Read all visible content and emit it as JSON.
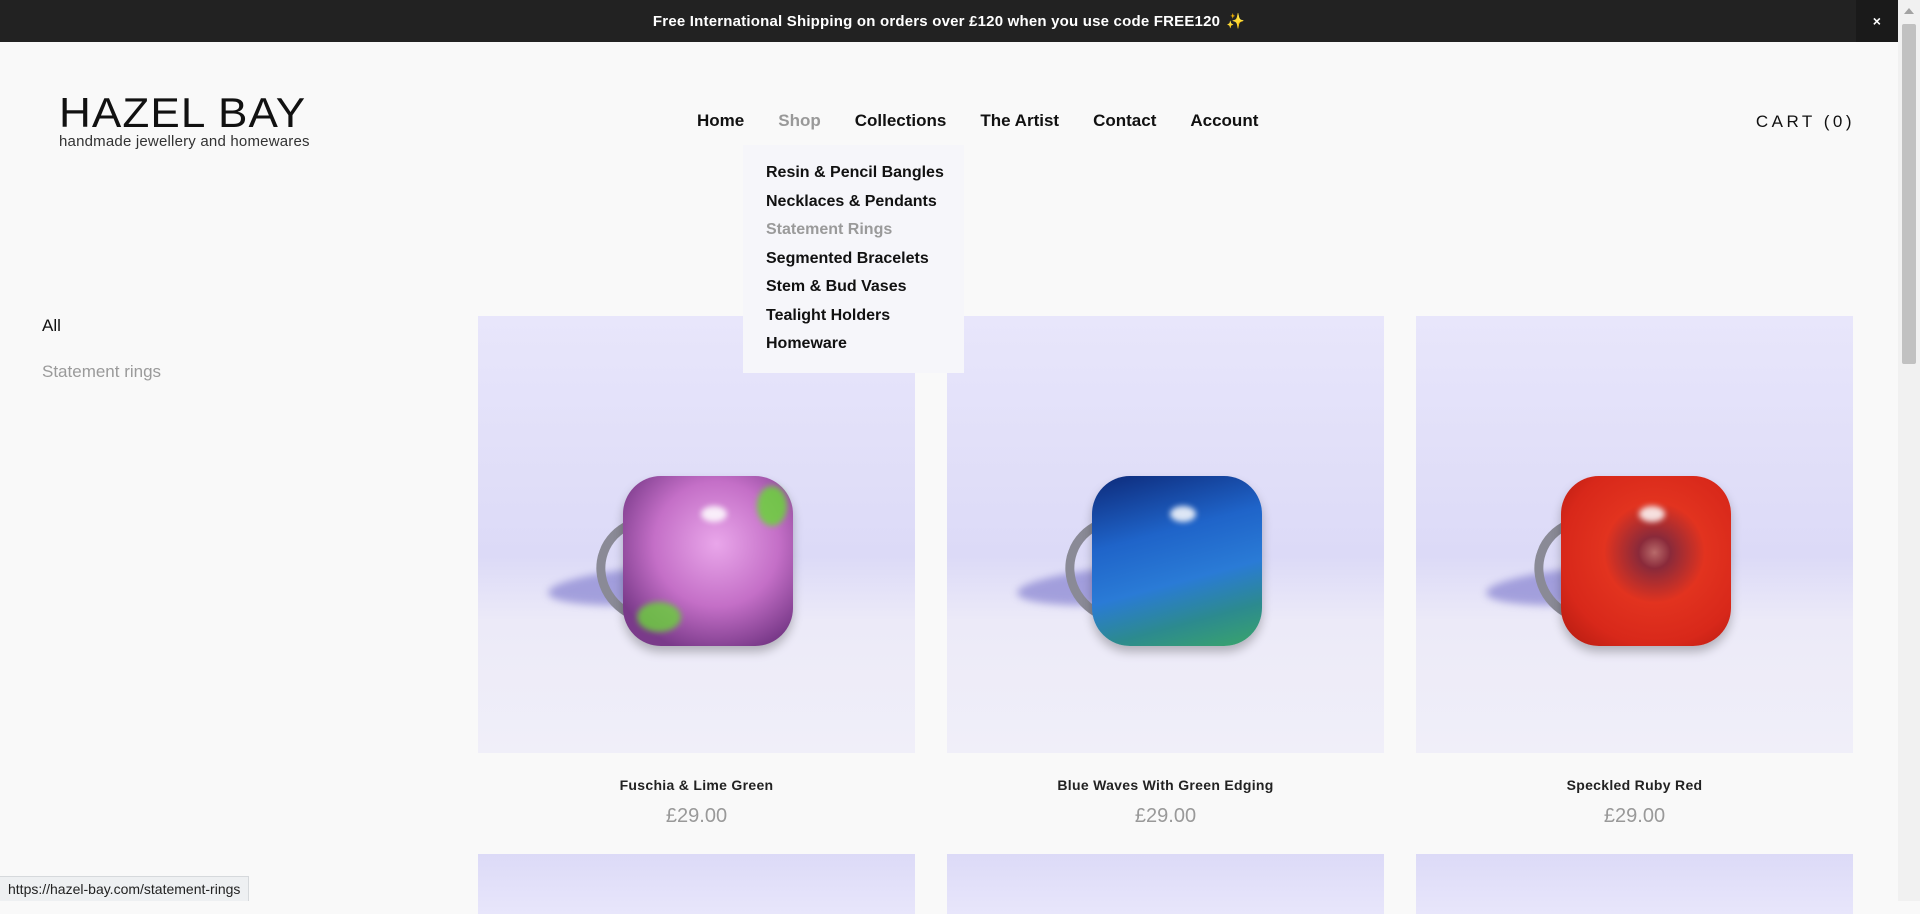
{
  "announcement": {
    "text": "Free International Shipping on orders over £120 when you use code FREE120",
    "emoji": "✨",
    "close_label": "×"
  },
  "logo": {
    "title": "HAZEL BAY",
    "tagline": "handmade jewellery and homewares"
  },
  "nav": {
    "items": [
      {
        "label": "Home"
      },
      {
        "label": "Shop",
        "active": true
      },
      {
        "label": "Collections"
      },
      {
        "label": "The Artist"
      },
      {
        "label": "Contact"
      },
      {
        "label": "Account"
      }
    ],
    "cart_label": "CART (0)"
  },
  "shop_dropdown": {
    "items": [
      {
        "label": "Resin & Pencil Bangles"
      },
      {
        "label": "Necklaces & Pendants"
      },
      {
        "label": "Statement Rings",
        "active": true
      },
      {
        "label": "Segmented Bracelets"
      },
      {
        "label": "Stem & Bud Vases"
      },
      {
        "label": "Tealight Holders"
      },
      {
        "label": "Homeware"
      }
    ]
  },
  "filters": [
    {
      "label": "All"
    },
    {
      "label": "Statement rings",
      "active": true
    }
  ],
  "products": [
    {
      "name": "Fuschia & Lime Green",
      "price": "£29.00",
      "stone_color": "#c46fc7",
      "accent": "#6ad43a"
    },
    {
      "name": "Blue Waves With Green Edging",
      "price": "£29.00",
      "stone_color": "#1f64c9",
      "accent": "#3aa56a"
    },
    {
      "name": "Speckled Ruby Red",
      "price": "£29.00",
      "stone_color": "#e2331f",
      "accent": "#8a2a3a"
    }
  ],
  "status_url": "https://hazel-bay.com/statement-rings"
}
